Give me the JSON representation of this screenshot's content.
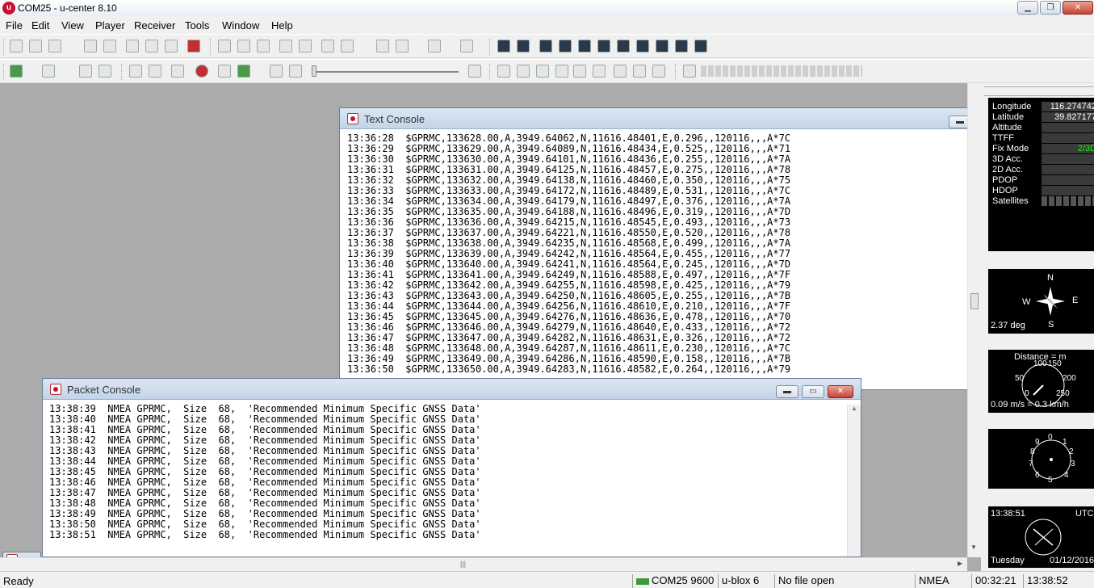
{
  "window": {
    "title": "COM25 - u-center 8.10",
    "icon": "u-center-logo-icon"
  },
  "menu": [
    "File",
    "Edit",
    "View",
    "Player",
    "Receiver",
    "Tools",
    "Window",
    "Help"
  ],
  "text_console": {
    "title": "Text Console",
    "lines": [
      "13:36:28  $GPRMC,133628.00,A,3949.64062,N,11616.48401,E,0.296,,120116,,,A*7C",
      "13:36:29  $GPRMC,133629.00,A,3949.64089,N,11616.48434,E,0.525,,120116,,,A*71",
      "13:36:30  $GPRMC,133630.00,A,3949.64101,N,11616.48436,E,0.255,,120116,,,A*7A",
      "13:36:31  $GPRMC,133631.00,A,3949.64125,N,11616.48457,E,0.275,,120116,,,A*78",
      "13:36:32  $GPRMC,133632.00,A,3949.64138,N,11616.48460,E,0.350,,120116,,,A*75",
      "13:36:33  $GPRMC,133633.00,A,3949.64172,N,11616.48489,E,0.531,,120116,,,A*7C",
      "13:36:34  $GPRMC,133634.00,A,3949.64179,N,11616.48497,E,0.376,,120116,,,A*7A",
      "13:36:35  $GPRMC,133635.00,A,3949.64188,N,11616.48496,E,0.319,,120116,,,A*7D",
      "13:36:36  $GPRMC,133636.00,A,3949.64215,N,11616.48545,E,0.493,,120116,,,A*73",
      "13:36:37  $GPRMC,133637.00,A,3949.64221,N,11616.48550,E,0.520,,120116,,,A*78",
      "13:36:38  $GPRMC,133638.00,A,3949.64235,N,11616.48568,E,0.499,,120116,,,A*7A",
      "13:36:39  $GPRMC,133639.00,A,3949.64242,N,11616.48564,E,0.455,,120116,,,A*77",
      "13:36:40  $GPRMC,133640.00,A,3949.64241,N,11616.48564,E,0.245,,120116,,,A*7D",
      "13:36:41  $GPRMC,133641.00,A,3949.64249,N,11616.48588,E,0.497,,120116,,,A*7F",
      "13:36:42  $GPRMC,133642.00,A,3949.64255,N,11616.48598,E,0.425,,120116,,,A*79",
      "13:36:43  $GPRMC,133643.00,A,3949.64250,N,11616.48605,E,0.255,,120116,,,A*7B",
      "13:36:44  $GPRMC,133644.00,A,3949.64256,N,11616.48610,E,0.210,,120116,,,A*7F",
      "13:36:45  $GPRMC,133645.00,A,3949.64276,N,11616.48636,E,0.478,,120116,,,A*70",
      "13:36:46  $GPRMC,133646.00,A,3949.64279,N,11616.48640,E,0.433,,120116,,,A*72",
      "13:36:47  $GPRMC,133647.00,A,3949.64282,N,11616.48631,E,0.326,,120116,,,A*72",
      "13:36:48  $GPRMC,133648.00,A,3949.64287,N,11616.48611,E,0.230,,120116,,,A*7C",
      "13:36:49  $GPRMC,133649.00,A,3949.64286,N,11616.48590,E,0.158,,120116,,,A*7B",
      "13:36:50  $GPRMC,133650.00,A,3949.64283,N,11616.48582,E,0.264,,120116,,,A*79"
    ]
  },
  "packet_console": {
    "title": "Packet Console",
    "lines": [
      "13:38:39  NMEA GPRMC,  Size  68,  'Recommended Minimum Specific GNSS Data'",
      "13:38:40  NMEA GPRMC,  Size  68,  'Recommended Minimum Specific GNSS Data'",
      "13:38:41  NMEA GPRMC,  Size  68,  'Recommended Minimum Specific GNSS Data'",
      "13:38:42  NMEA GPRMC,  Size  68,  'Recommended Minimum Specific GNSS Data'",
      "13:38:43  NMEA GPRMC,  Size  68,  'Recommended Minimum Specific GNSS Data'",
      "13:38:44  NMEA GPRMC,  Size  68,  'Recommended Minimum Specific GNSS Data'",
      "13:38:45  NMEA GPRMC,  Size  68,  'Recommended Minimum Specific GNSS Data'",
      "13:38:46  NMEA GPRMC,  Size  68,  'Recommended Minimum Specific GNSS Data'",
      "13:38:47  NMEA GPRMC,  Size  68,  'Recommended Minimum Specific GNSS Data'",
      "13:38:48  NMEA GPRMC,  Size  68,  'Recommended Minimum Specific GNSS Data'",
      "13:38:49  NMEA GPRMC,  Size  68,  'Recommended Minimum Specific GNSS Data'",
      "13:38:50  NMEA GPRMC,  Size  68,  'Recommended Minimum Specific GNSS Data'",
      "13:38:51  NMEA GPRMC,  Size  68,  'Recommended Minimum Specific GNSS Data'"
    ]
  },
  "data_view": {
    "longitude_label": "Longitude",
    "longitude": "116.274742",
    "latitude_label": "Latitude",
    "latitude": "39.827177",
    "altitude_label": "Altitude",
    "ttff_label": "TTFF",
    "fixmode_label": "Fix Mode",
    "fixmode": "2/3D",
    "acc3d_label": "3D Acc.",
    "acc2d_label": "2D Acc.",
    "pdop_label": "PDOP",
    "hdop_label": "HDOP",
    "satellites_label": "Satellites"
  },
  "compass": {
    "n": "N",
    "s": "S",
    "e": "E",
    "w": "W",
    "heading": "2.37 deg"
  },
  "speedometer": {
    "label": "Distance = m",
    "ticks": [
      "100",
      "150",
      "50",
      "200",
      "0",
      "250"
    ],
    "readout": "0.09 m/s = 0.3 km/h"
  },
  "altimeter": {
    "ticks": [
      "0",
      "1",
      "2",
      "3",
      "4",
      "5",
      "6",
      "7",
      "8",
      "9"
    ]
  },
  "clock": {
    "time": "13:38:51",
    "zone": "UTC",
    "day": "Tuesday",
    "date": "01/12/2016"
  },
  "status": {
    "ready": "Ready",
    "port": "COM25 9600",
    "receiver": "u-blox 6",
    "file": "No file open",
    "protocol": "NMEA",
    "elapsed": "00:32:21",
    "time": "13:38:52"
  },
  "colors": {
    "accent": "#c8102e",
    "fix_green": "#00ff00"
  }
}
